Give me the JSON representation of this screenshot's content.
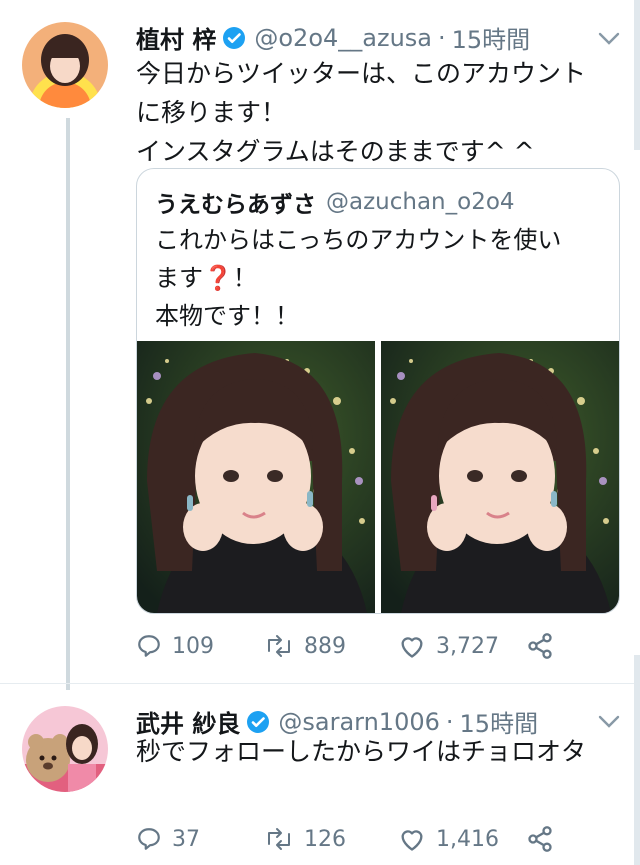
{
  "tweets": [
    {
      "display_name": "植村 梓",
      "handle": "@o2o4__azusa",
      "separator": "·",
      "time": "15時間",
      "text": "今日からツイッターは、このアカウント\nに移ります！\nインスタグラムはそのままです^ ^",
      "quote": {
        "display_name": "うえむらあずさ",
        "handle": "@azuchan_o2o4",
        "text": "これからはこっちのアカウントを使い\nます❓！\n本物です！！"
      },
      "stats": {
        "replies": "109",
        "retweets": "889",
        "likes": "3,727"
      }
    },
    {
      "display_name": "武井 紗良",
      "handle": "@sararn1006",
      "separator": "·",
      "time": "15時間",
      "text": "秒でフォローしたからワイはチョロオタ",
      "stats": {
        "replies": "37",
        "retweets": "126",
        "likes": "1,416"
      }
    }
  ],
  "icons": [
    "verified-icon",
    "chevron-down-icon",
    "reply-icon",
    "retweet-icon",
    "like-icon",
    "share-icon"
  ],
  "colors": {
    "verified": "#1da1f2",
    "text": "#14171a",
    "muted": "#657786",
    "border": "#ccd6dd"
  }
}
